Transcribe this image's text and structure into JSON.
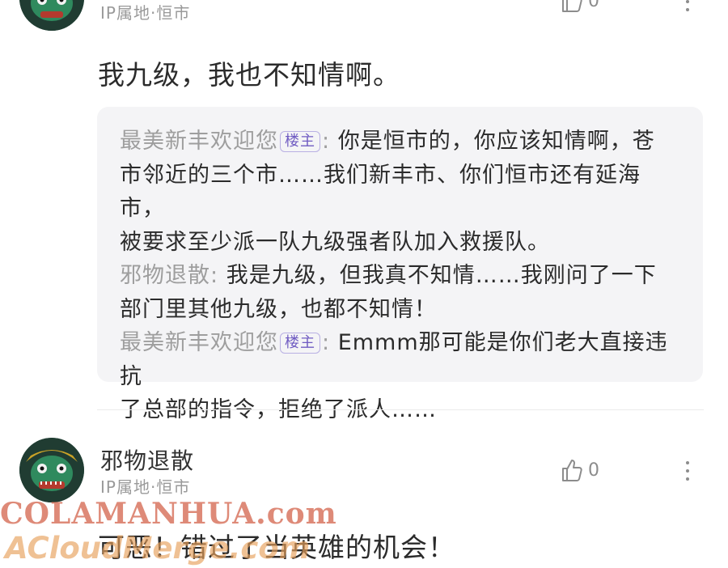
{
  "comment1": {
    "ip": "IP属地·恒市",
    "like_count": "0",
    "text": "我九级，我也不知情啊。",
    "replies": [
      {
        "author": "最美新丰欢迎您",
        "badge": "楼主",
        "colon": ":",
        "line1": " 你是恒市的，你应该知情啊，苍",
        "line2": "市邻近的三个市……我们新丰市、你们恒市还有延海市，",
        "line3": "被要求至少派一队九级强者队加入救援队。"
      },
      {
        "author": "邪物退散",
        "colon": ":",
        "line1": " 我是九级，但我真不知情……我刚问了一下",
        "line2": "部门里其他九级，也都不知情！"
      },
      {
        "author": "最美新丰欢迎您",
        "badge": "楼主",
        "colon": ":",
        "line1": " Emmm那可能是你们老大直接违抗",
        "line2": "了总部的指令，拒绝了派人……"
      }
    ]
  },
  "comment2": {
    "username": "邪物退散",
    "ip": "IP属地·恒市",
    "like_count": "0",
    "text": "可恶！错过了当英雄的机会！"
  },
  "watermark": {
    "line1": "COLAMANHUA.com",
    "line2": "ACloudMerge.com"
  },
  "colors": {
    "badge_text": "#6f5bc2",
    "reply_bg": "#f4f4f6",
    "watermark_blue": "#5d8fbf",
    "watermark_red": "#d4644b",
    "watermark_orange": "#e8a15c"
  },
  "icons": [
    "avatar",
    "thumbs-up-icon",
    "more-vertical-icon"
  ]
}
